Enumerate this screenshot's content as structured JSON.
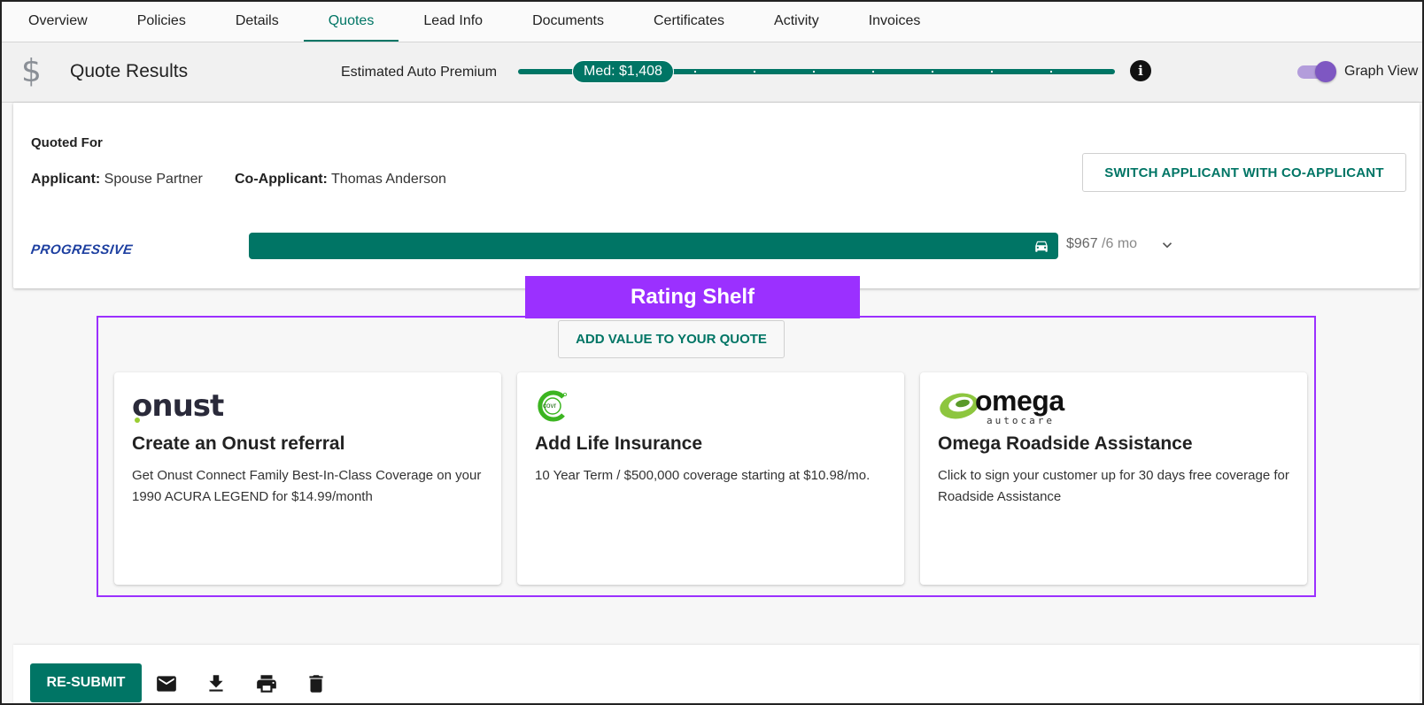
{
  "tabs": [
    {
      "label": "Overview"
    },
    {
      "label": "Policies"
    },
    {
      "label": "Details"
    },
    {
      "label": "Quotes",
      "active": true
    },
    {
      "label": "Lead Info"
    },
    {
      "label": "Documents"
    },
    {
      "label": "Certificates"
    },
    {
      "label": "Activity"
    },
    {
      "label": "Invoices"
    }
  ],
  "header": {
    "icon": "dollar-icon",
    "title": "Quote Results",
    "premium_label": "Estimated Auto Premium",
    "slider_value": "Med: $1,408",
    "toggle_label": "Graph View",
    "toggle_on": true
  },
  "quoted_for": {
    "title": "Quoted For",
    "applicant_label": "Applicant:",
    "applicant_name": "Spouse Partner",
    "coapplicant_label": "Co-Applicant:",
    "coapplicant_name": "Thomas Anderson",
    "switch_button": "SWITCH APPLICANT WITH CO-APPLICANT"
  },
  "quote": {
    "carrier": "PROGRESSIVE",
    "price": "$967",
    "period": "/6 mo"
  },
  "shelf": {
    "label": "Rating Shelf",
    "add_value_button": "ADD VALUE TO YOUR QUOTE",
    "cards": [
      {
        "logo": "onust",
        "title": "Create an Onust referral",
        "description": "Get Onust Connect Family Best-In-Class Coverage on your 1990 ACURA LEGEND for $14.99/month"
      },
      {
        "logo": "covr",
        "title": "Add Life Insurance",
        "description": "10 Year Term / $500,000 coverage starting at $10.98/mo."
      },
      {
        "logo": "omega",
        "logo_sub": "autocare",
        "title": "Omega Roadside Assistance",
        "description": "Click to sign your customer up for 30 days free coverage for Roadside Assistance"
      }
    ]
  },
  "footer": {
    "resubmit_button": "RE-SUBMIT",
    "icons": [
      "email-icon",
      "download-icon",
      "print-icon",
      "delete-icon"
    ]
  },
  "colors": {
    "accent": "#007565",
    "shelf": "#9b30ff",
    "progressive": "#1d3fa0"
  }
}
